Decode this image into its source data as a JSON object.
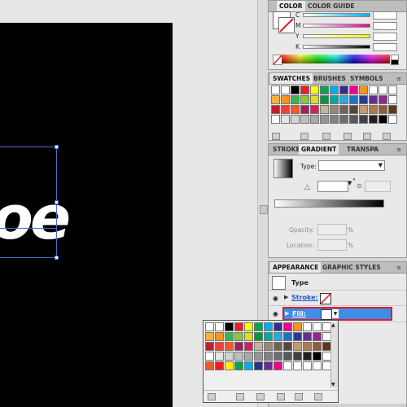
{
  "canvas": {
    "glyph_text": "oe"
  },
  "color_panel": {
    "tabs": [
      "COLOR",
      "COLOR GUIDE"
    ],
    "channels": [
      {
        "label": "C",
        "color": "#00aeef"
      },
      {
        "label": "M",
        "color": "#ec008c"
      },
      {
        "label": "Y",
        "color": "#fff200"
      },
      {
        "label": "K",
        "color": "#231f20"
      }
    ]
  },
  "swatches_panel": {
    "tabs": [
      "SWATCHES",
      "BRUSHES",
      "SYMBOLS"
    ],
    "rows": [
      [
        "#ffffff",
        "#ffffff",
        "#000000",
        "#ed1c24",
        "#ffff00",
        "#00a651",
        "#00aeef",
        "#2e3192",
        "#ec008c",
        "#f7941d",
        "#ffffff",
        "#ffffff",
        "#ffffff"
      ],
      [
        "#fbb040",
        "#f7941d",
        "#39b54a",
        "#8dc63f",
        "#d7df23",
        "#009444",
        "#00a99d",
        "#27aae1",
        "#1c75bc",
        "#2b3990",
        "#662d91",
        "#92278f",
        "#ffffff"
      ],
      [
        "#be1e2d",
        "#ef4136",
        "#f15a29",
        "#9e1f63",
        "#da1c5c",
        "#c2b59b",
        "#998675",
        "#736357",
        "#534741",
        "#c49a6c",
        "#a97c50",
        "#8b5e3c",
        "#603913"
      ],
      [
        "#ffffff",
        "#e6e6e6",
        "#d1d3d4",
        "#bcbec0",
        "#a7a9ac",
        "#939598",
        "#808285",
        "#6d6e71",
        "#58595b",
        "#414042",
        "#231f20",
        "#000000",
        "#ffffff"
      ]
    ]
  },
  "gradient_panel": {
    "tabs": [
      "STROKE",
      "GRADIENT",
      "TRANSPA"
    ],
    "type_label": "Type:",
    "opacity_label": "Opacity:",
    "location_label": "Location:",
    "percent": "%"
  },
  "appearance_panel": {
    "tabs": [
      "APPEARANCE",
      "GRAPHIC STYLES"
    ],
    "title": "Type",
    "stroke_label": "Stroke:",
    "fill_label": "Fill:",
    "highlight_color": "#3d8ee6",
    "outline_color": "#e8192c"
  },
  "popup_swatches": {
    "rows": [
      [
        "#ffffff",
        "#ffffff",
        "#000000",
        "#ed1c24",
        "#ffff00",
        "#00a651",
        "#00aeef",
        "#2e3192",
        "#ec008c",
        "#f7941d",
        "#ffffff",
        "#ffffff",
        "#ffffff"
      ],
      [
        "#fbb040",
        "#f7941d",
        "#39b54a",
        "#8dc63f",
        "#d7df23",
        "#009444",
        "#00a99d",
        "#27aae1",
        "#1c75bc",
        "#2b3990",
        "#662d91",
        "#92278f",
        "#ffffff"
      ],
      [
        "#be1e2d",
        "#ef4136",
        "#f15a29",
        "#9e1f63",
        "#da1c5c",
        "#c2b59b",
        "#998675",
        "#736357",
        "#534741",
        "#c49a6c",
        "#a97c50",
        "#8b5e3c",
        "#603913"
      ],
      [
        "#ffffff",
        "#e6e6e6",
        "#d1d3d4",
        "#bcbec0",
        "#a7a9ac",
        "#939598",
        "#808285",
        "#6d6e71",
        "#58595b",
        "#414042",
        "#231f20",
        "#000000",
        "#ffffff"
      ],
      [
        "#f15a24",
        "#ed1c24",
        "#fff200",
        "#00a651",
        "#00aeef",
        "#2e3192",
        "#662d91",
        "#ec008c",
        "#ffffff",
        "#ffffff",
        "#ffffff",
        "#ffffff",
        "#ffffff"
      ]
    ]
  }
}
